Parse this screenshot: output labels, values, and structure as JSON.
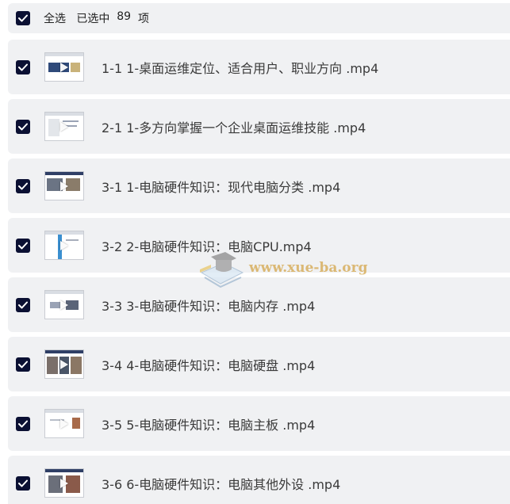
{
  "select_all": {
    "label": "全选",
    "selected_prefix": "已选中",
    "selected_count": "89",
    "selected_suffix": "项",
    "checked": true
  },
  "files": [
    {
      "name": "1-1 1-桌面运维定位、适合用户、职业方向 .mp4",
      "checked": true
    },
    {
      "name": "2-1 1-多方向掌握一个企业桌面运维技能 .mp4",
      "checked": true
    },
    {
      "name": "3-1 1-电脑硬件知识：现代电脑分类 .mp4",
      "checked": true
    },
    {
      "name": "3-2 2-电脑硬件知识：电脑CPU.mp4",
      "checked": true
    },
    {
      "name": "3-3 3-电脑硬件知识：电脑内存 .mp4",
      "checked": true
    },
    {
      "name": "3-4 4-电脑硬件知识：电脑硬盘 .mp4",
      "checked": true
    },
    {
      "name": "3-5 5-电脑硬件知识：电脑主板 .mp4",
      "checked": true
    },
    {
      "name": "3-6 6-电脑硬件知识：电脑其他外设 .mp4",
      "checked": true
    }
  ],
  "watermark": {
    "text": "www.xue-ba.org"
  },
  "colors": {
    "checkbox": "#0b1033",
    "row_bg": "#f0f1f3",
    "watermark": "#d4a64a"
  }
}
